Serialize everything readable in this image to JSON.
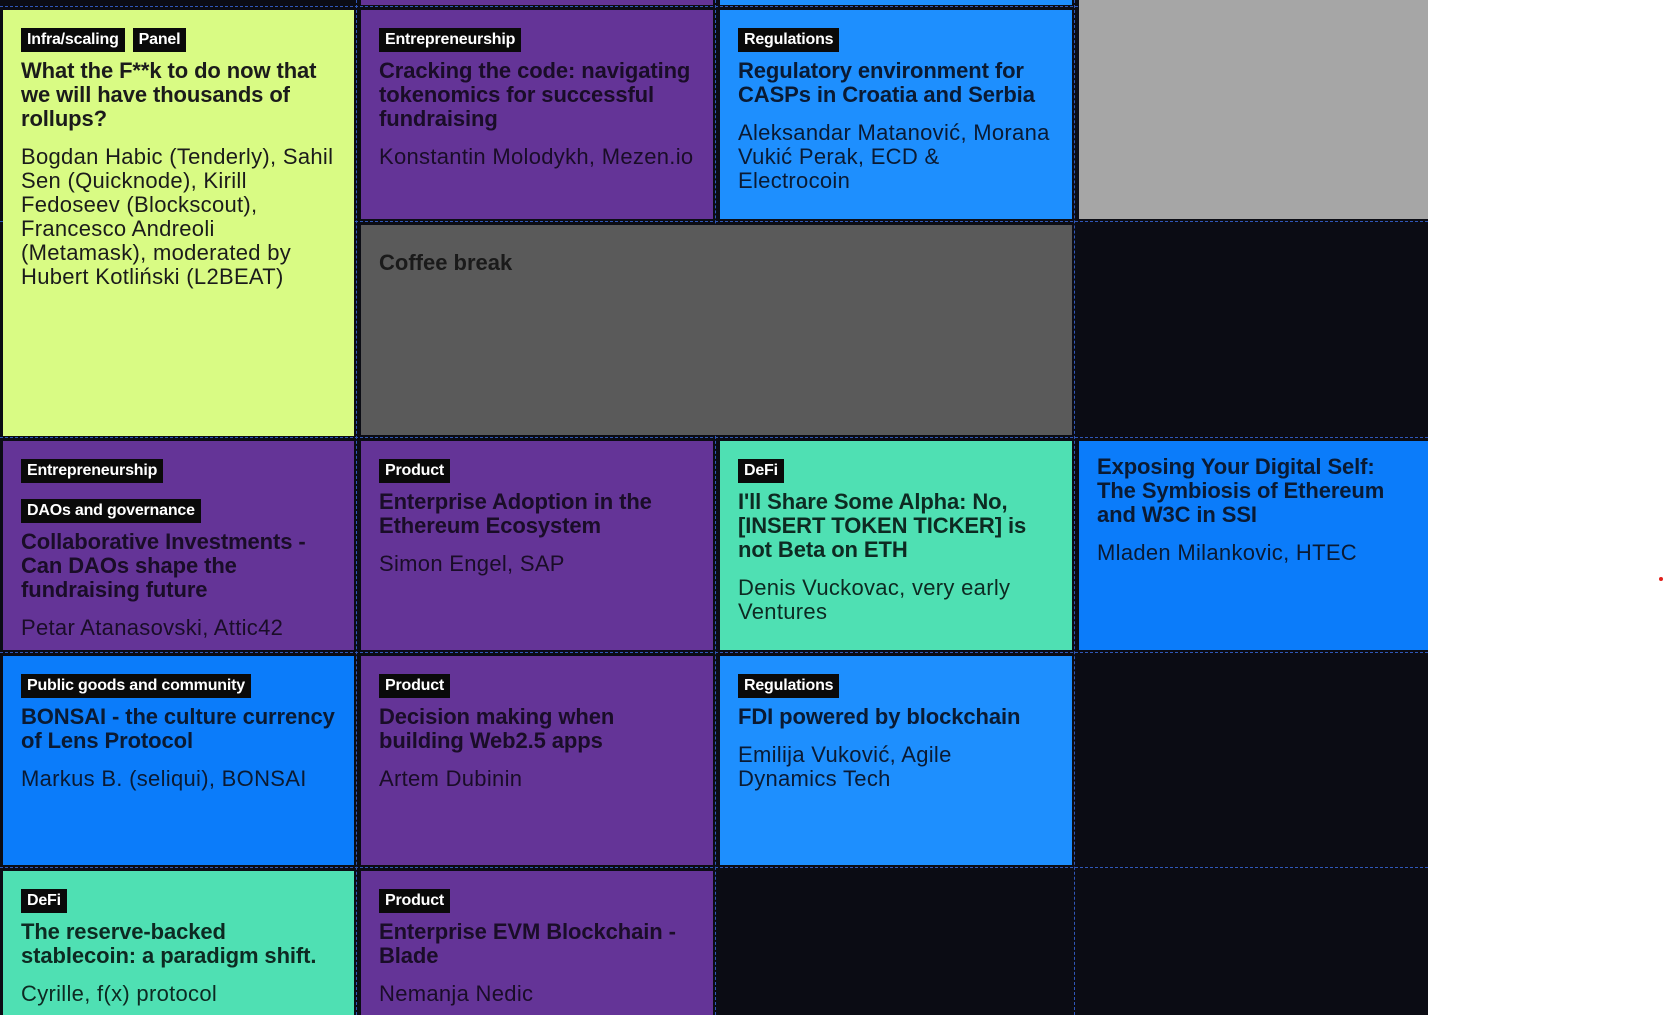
{
  "sessions": {
    "rollups": {
      "tags": [
        "Infra/scaling",
        "Panel"
      ],
      "title": "What the F**k to do now that we will have thousands of rollups?",
      "speakers": "Bogdan Habic (Tenderly), Sahil Sen (Quicknode), Kirill Fedoseev (Blockscout), Francesco Andreoli (Metamask), moderated by Hubert Kotliński (L2BEAT)"
    },
    "tokenomics": {
      "tags": [
        "Entrepreneurship"
      ],
      "title": "Cracking the code: navigating tokenomics for successful fundraising",
      "speakers": "Konstantin Molodykh, Mezen.io"
    },
    "regulatory": {
      "tags": [
        "Regulations"
      ],
      "title": "Regulatory environment for CASPs in Croatia and Serbia",
      "speakers": "Aleksandar Matanović, Morana Vukić Perak, ECD & Electrocoin"
    },
    "coffee": {
      "title": "Coffee break"
    },
    "daos": {
      "tags": [
        "Entrepreneurship",
        "DAOs and governance"
      ],
      "title": "Collaborative Investments - Can DAOs shape the fundraising future",
      "speakers": "Petar Atanasovski, Attic42"
    },
    "enterprise": {
      "tags": [
        "Product"
      ],
      "title": "Enterprise Adoption in the Ethereum Ecosystem",
      "speakers": "Simon Engel, SAP"
    },
    "alpha": {
      "tags": [
        "DeFi"
      ],
      "title": "I'll Share Some Alpha: No, [INSERT TOKEN TICKER] is not Beta on ETH",
      "speakers": "Denis Vuckovac, very early Ventures"
    },
    "ssi": {
      "title": "Exposing Your Digital Self: The Symbiosis of Ethereum and W3C in SSI",
      "speakers": "Mladen Milankovic, HTEC"
    },
    "bonsai": {
      "tags": [
        "Public goods and community"
      ],
      "title": "BONSAI - the culture currency of Lens Protocol",
      "speakers": "Markus B. (seliqui), BONSAI"
    },
    "web25": {
      "tags": [
        "Product"
      ],
      "title": "Decision making when building Web2.5 apps",
      "speakers": "Artem Dubinin"
    },
    "fdi": {
      "tags": [
        "Regulations"
      ],
      "title": "FDI powered by blockchain",
      "speakers": "Emilija Vuković, Agile Dynamics Tech"
    },
    "stablecoin": {
      "tags": [
        "DeFi"
      ],
      "title": "The reserve-backed stablecoin: a paradigm shift.",
      "speakers": "Cyrille, f(x) protocol"
    },
    "blade": {
      "tags": [
        "Product"
      ],
      "title": "Enterprise EVM Blockchain - Blade",
      "speakers": "Nemanja Nedic"
    }
  },
  "colors": {
    "lime": "#d9fb84",
    "purple": "#643497",
    "blue": "#1e8ffe",
    "bright_blue": "#0b7cfa",
    "green": "#4fe0b3",
    "gray": "#5a5a5a",
    "empty": "#0b0c14"
  }
}
